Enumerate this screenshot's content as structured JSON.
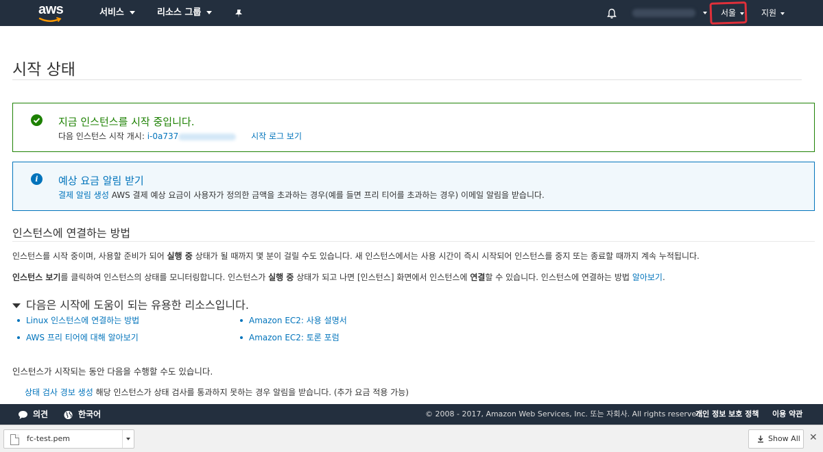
{
  "topnav": {
    "logo_text": "aws",
    "services_label": "서비스",
    "resource_groups_label": "리소스 그룹",
    "region_label": "서울",
    "support_label": "지원"
  },
  "page": {
    "title": "시작 상태"
  },
  "success_alert": {
    "title": "지금 인스턴스를 시작 중입니다.",
    "body_prefix": "다음 인스턴스 시작 개시:",
    "instance_id": "i-0a737",
    "log_link": "시작 로그 보기"
  },
  "info_alert": {
    "title": "예상 요금 알림 받기",
    "link": "결제 알림 생성",
    "body": "AWS 결제 예상 요금이 사용자가 정의한 금액을 초과하는 경우(예를 들면 프리 티어를 초과하는 경우) 이메일 알림을 받습니다."
  },
  "connect_section": {
    "title": "인스턴스에 연결하는 방법",
    "p1_a": "인스턴스를 시작 중이며, 사용할 준비가 되어 ",
    "p1_b": "실행 중",
    "p1_c": " 상태가 될 때까지 몇 분이 걸릴 수도 있습니다. 새 인스턴스에서는 사용 시간이 즉시 시작되어 인스턴스를 중지 또는 종료할 때까지 계속 누적됩니다.",
    "p2_a": "인스턴스 보기",
    "p2_b": "를 클릭하여 인스턴스의 상태를 모니터링합니다. 인스턴스가 ",
    "p2_c": "실행 중",
    "p2_d": " 상태가 되고 나면 [인스턴스] 화면에서 인스턴스에 ",
    "p2_e": "연결",
    "p2_f": "할 수 있습니다. 인스턴스에 연결하는 방법 ",
    "p2_link": "알아보기",
    "p2_end": "."
  },
  "resources": {
    "title": "다음은 시작에 도움이 되는 유용한 리소스입니다.",
    "left": [
      "Linux 인스턴스에 연결하는 방법",
      "AWS 프리 티어에 대해 알아보기"
    ],
    "right": [
      "Amazon EC2: 사용 설명서",
      "Amazon EC2: 토론 포럼"
    ]
  },
  "while_launching": {
    "text": "인스턴스가 시작되는 동안 다음을 수행할 수도 있습니다.",
    "link": "상태 검사 경보 생성",
    "desc": "해당 인스턴스가 상태 검사를 통과하지 못하는 경우 알림을 받습니다. (추가 요금 적용 가능)"
  },
  "footer": {
    "feedback": "의견",
    "language": "한국어",
    "copyright": "© 2008 - 2017, Amazon Web Services, Inc. 또는 자회사. All rights reserved.",
    "privacy": "개인 정보 보호 정책",
    "terms": "이용 약관"
  },
  "download_bar": {
    "file_name": "fc-test.pem",
    "show_all": "Show All",
    "close": "✕"
  },
  "colors": {
    "nav_bg": "#232f3e",
    "link": "#0073bb",
    "success": "#1d8102",
    "info_bg": "#f1f8fc",
    "highlight": "#e0303a"
  },
  "icons": [
    "bell-icon",
    "pin-icon",
    "check-circle-icon",
    "info-circle-icon",
    "chat-bubble-icon",
    "globe-icon",
    "download-icon",
    "file-icon"
  ]
}
